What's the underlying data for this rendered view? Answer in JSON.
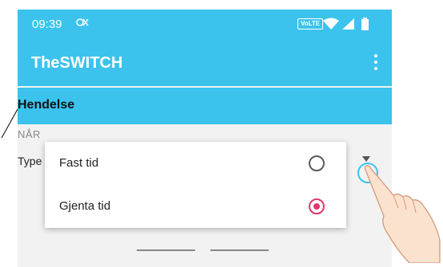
{
  "statusbar": {
    "time": "09:39",
    "volte": "VoLTE",
    "app_icon": "notification-app-icon"
  },
  "appbar": {
    "title": "TheSWITCH",
    "menu_icon": "more-vert-icon"
  },
  "section": {
    "title": "Hendelse"
  },
  "content": {
    "when_label": "NÅR",
    "type_label": "Type"
  },
  "popup": {
    "options": [
      {
        "label": "Fast tid",
        "selected": false
      },
      {
        "label": "Gjenta tid",
        "selected": true
      }
    ]
  },
  "colors": {
    "accent": "#3bc3ee",
    "radio_selected": "#e8336d",
    "radio_unselected": "#5a5a5a"
  }
}
